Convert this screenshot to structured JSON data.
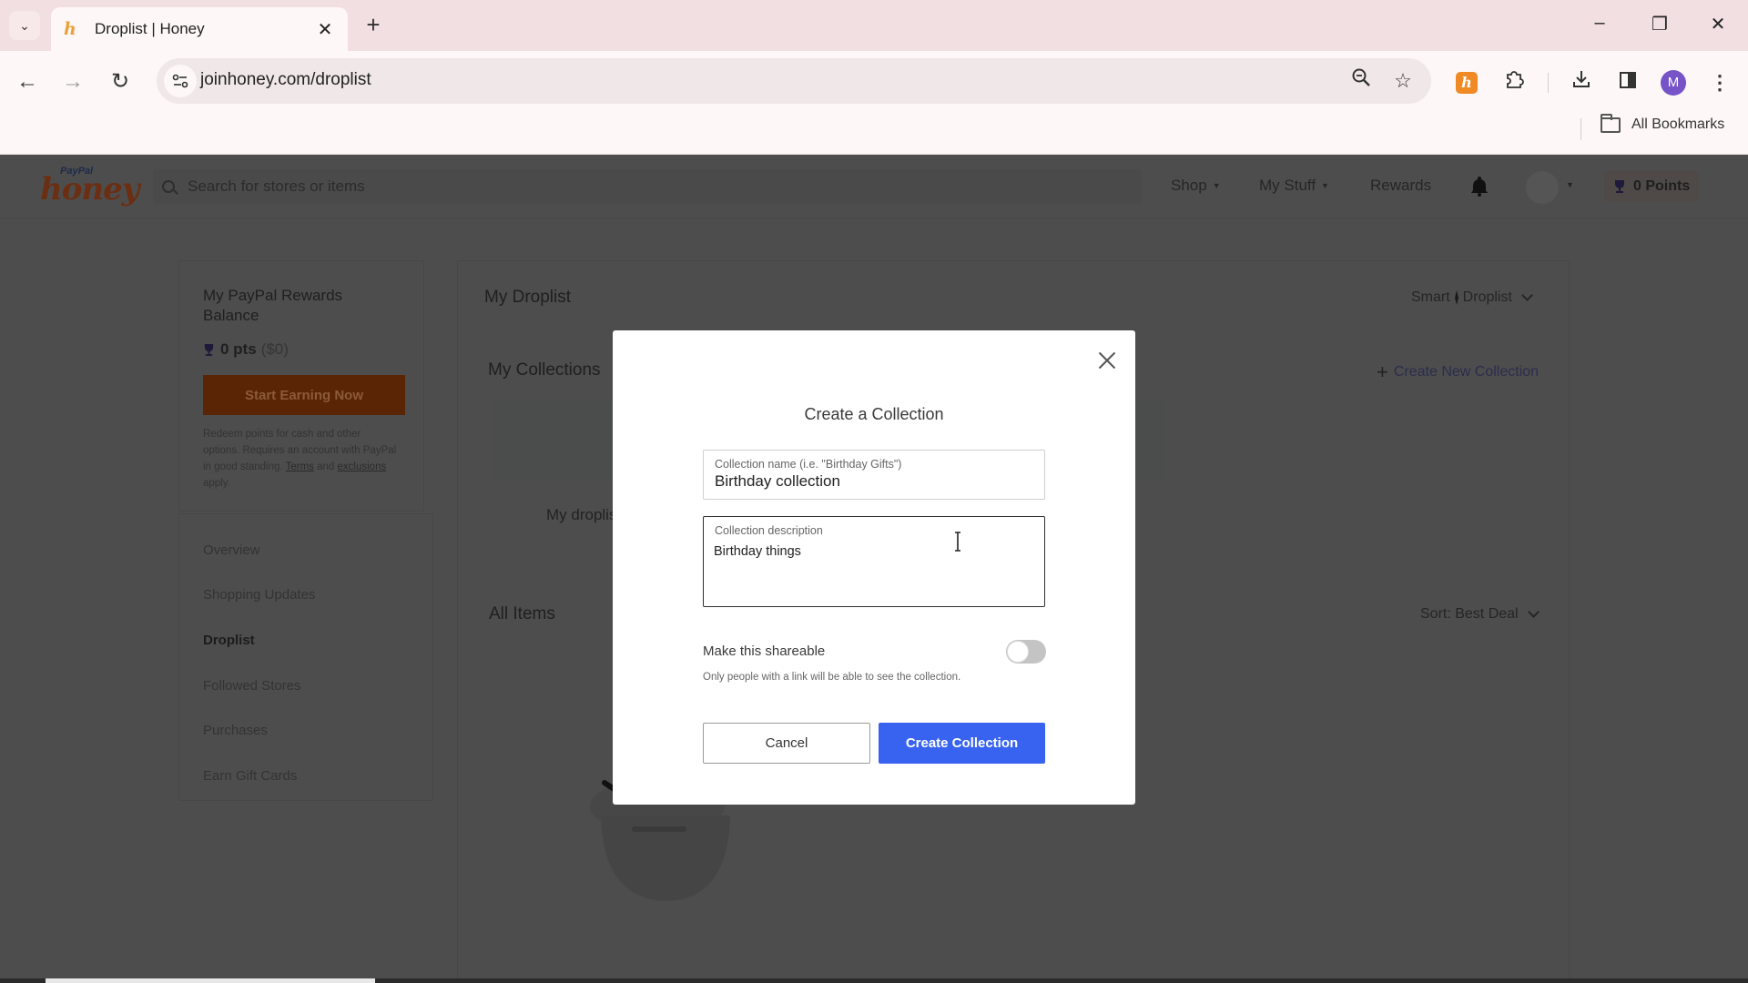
{
  "browser": {
    "tab_title": "Droplist | Honey",
    "url": "joinhoney.com/droplist",
    "profile_initial": "M",
    "bookmarks_label": "All Bookmarks",
    "extension_letter": "h"
  },
  "header": {
    "logo_brand": "PayPal",
    "logo_text": "honey",
    "search_placeholder": "Search for stores or items",
    "nav": [
      {
        "label": "Shop",
        "has_caret": true
      },
      {
        "label": "My Stuff",
        "has_caret": true
      },
      {
        "label": "Rewards",
        "has_caret": false
      }
    ],
    "points_label": "0 Points"
  },
  "sidebar": {
    "rewards_title": "My PayPal Rewards Balance",
    "points": "0 pts",
    "points_usd": "($0)",
    "earn_button": "Start Earning Now",
    "fine_print_prefix": "Redeem points for cash and other options. Requires an account with PayPal in good standing.",
    "terms_link": "Terms",
    "fine_print_and": "and",
    "exclusions_link": "exclusions",
    "fine_print_suffix": "apply.",
    "menu": [
      {
        "label": "Overview",
        "active": false
      },
      {
        "label": "Shopping Updates",
        "active": false
      },
      {
        "label": "Droplist",
        "active": true
      },
      {
        "label": "Followed Stores",
        "active": false
      },
      {
        "label": "Purchases",
        "active": false
      },
      {
        "label": "Earn Gift Cards",
        "active": false
      }
    ]
  },
  "main": {
    "title": "My Droplist",
    "smart_droplist_prefix": "Smart",
    "smart_droplist_suffix": "Droplist",
    "collections_heading": "My Collections",
    "create_new_collection": "Create New Collection",
    "collection_card_label": "My droplist",
    "all_items_heading": "All Items",
    "sort_label": "Sort: Best Deal"
  },
  "modal": {
    "title": "Create a Collection",
    "name_label": "Collection name (i.e. \"Birthday Gifts\")",
    "name_value": "Birthday collection",
    "description_label": "Collection description",
    "description_value": "Birthday things",
    "shareable_label": "Make this shareable",
    "shareable_enabled": false,
    "shareable_hint": "Only people with a link will be able to see the collection.",
    "cancel_label": "Cancel",
    "create_label": "Create Collection",
    "primary_color": "#3863f0"
  }
}
